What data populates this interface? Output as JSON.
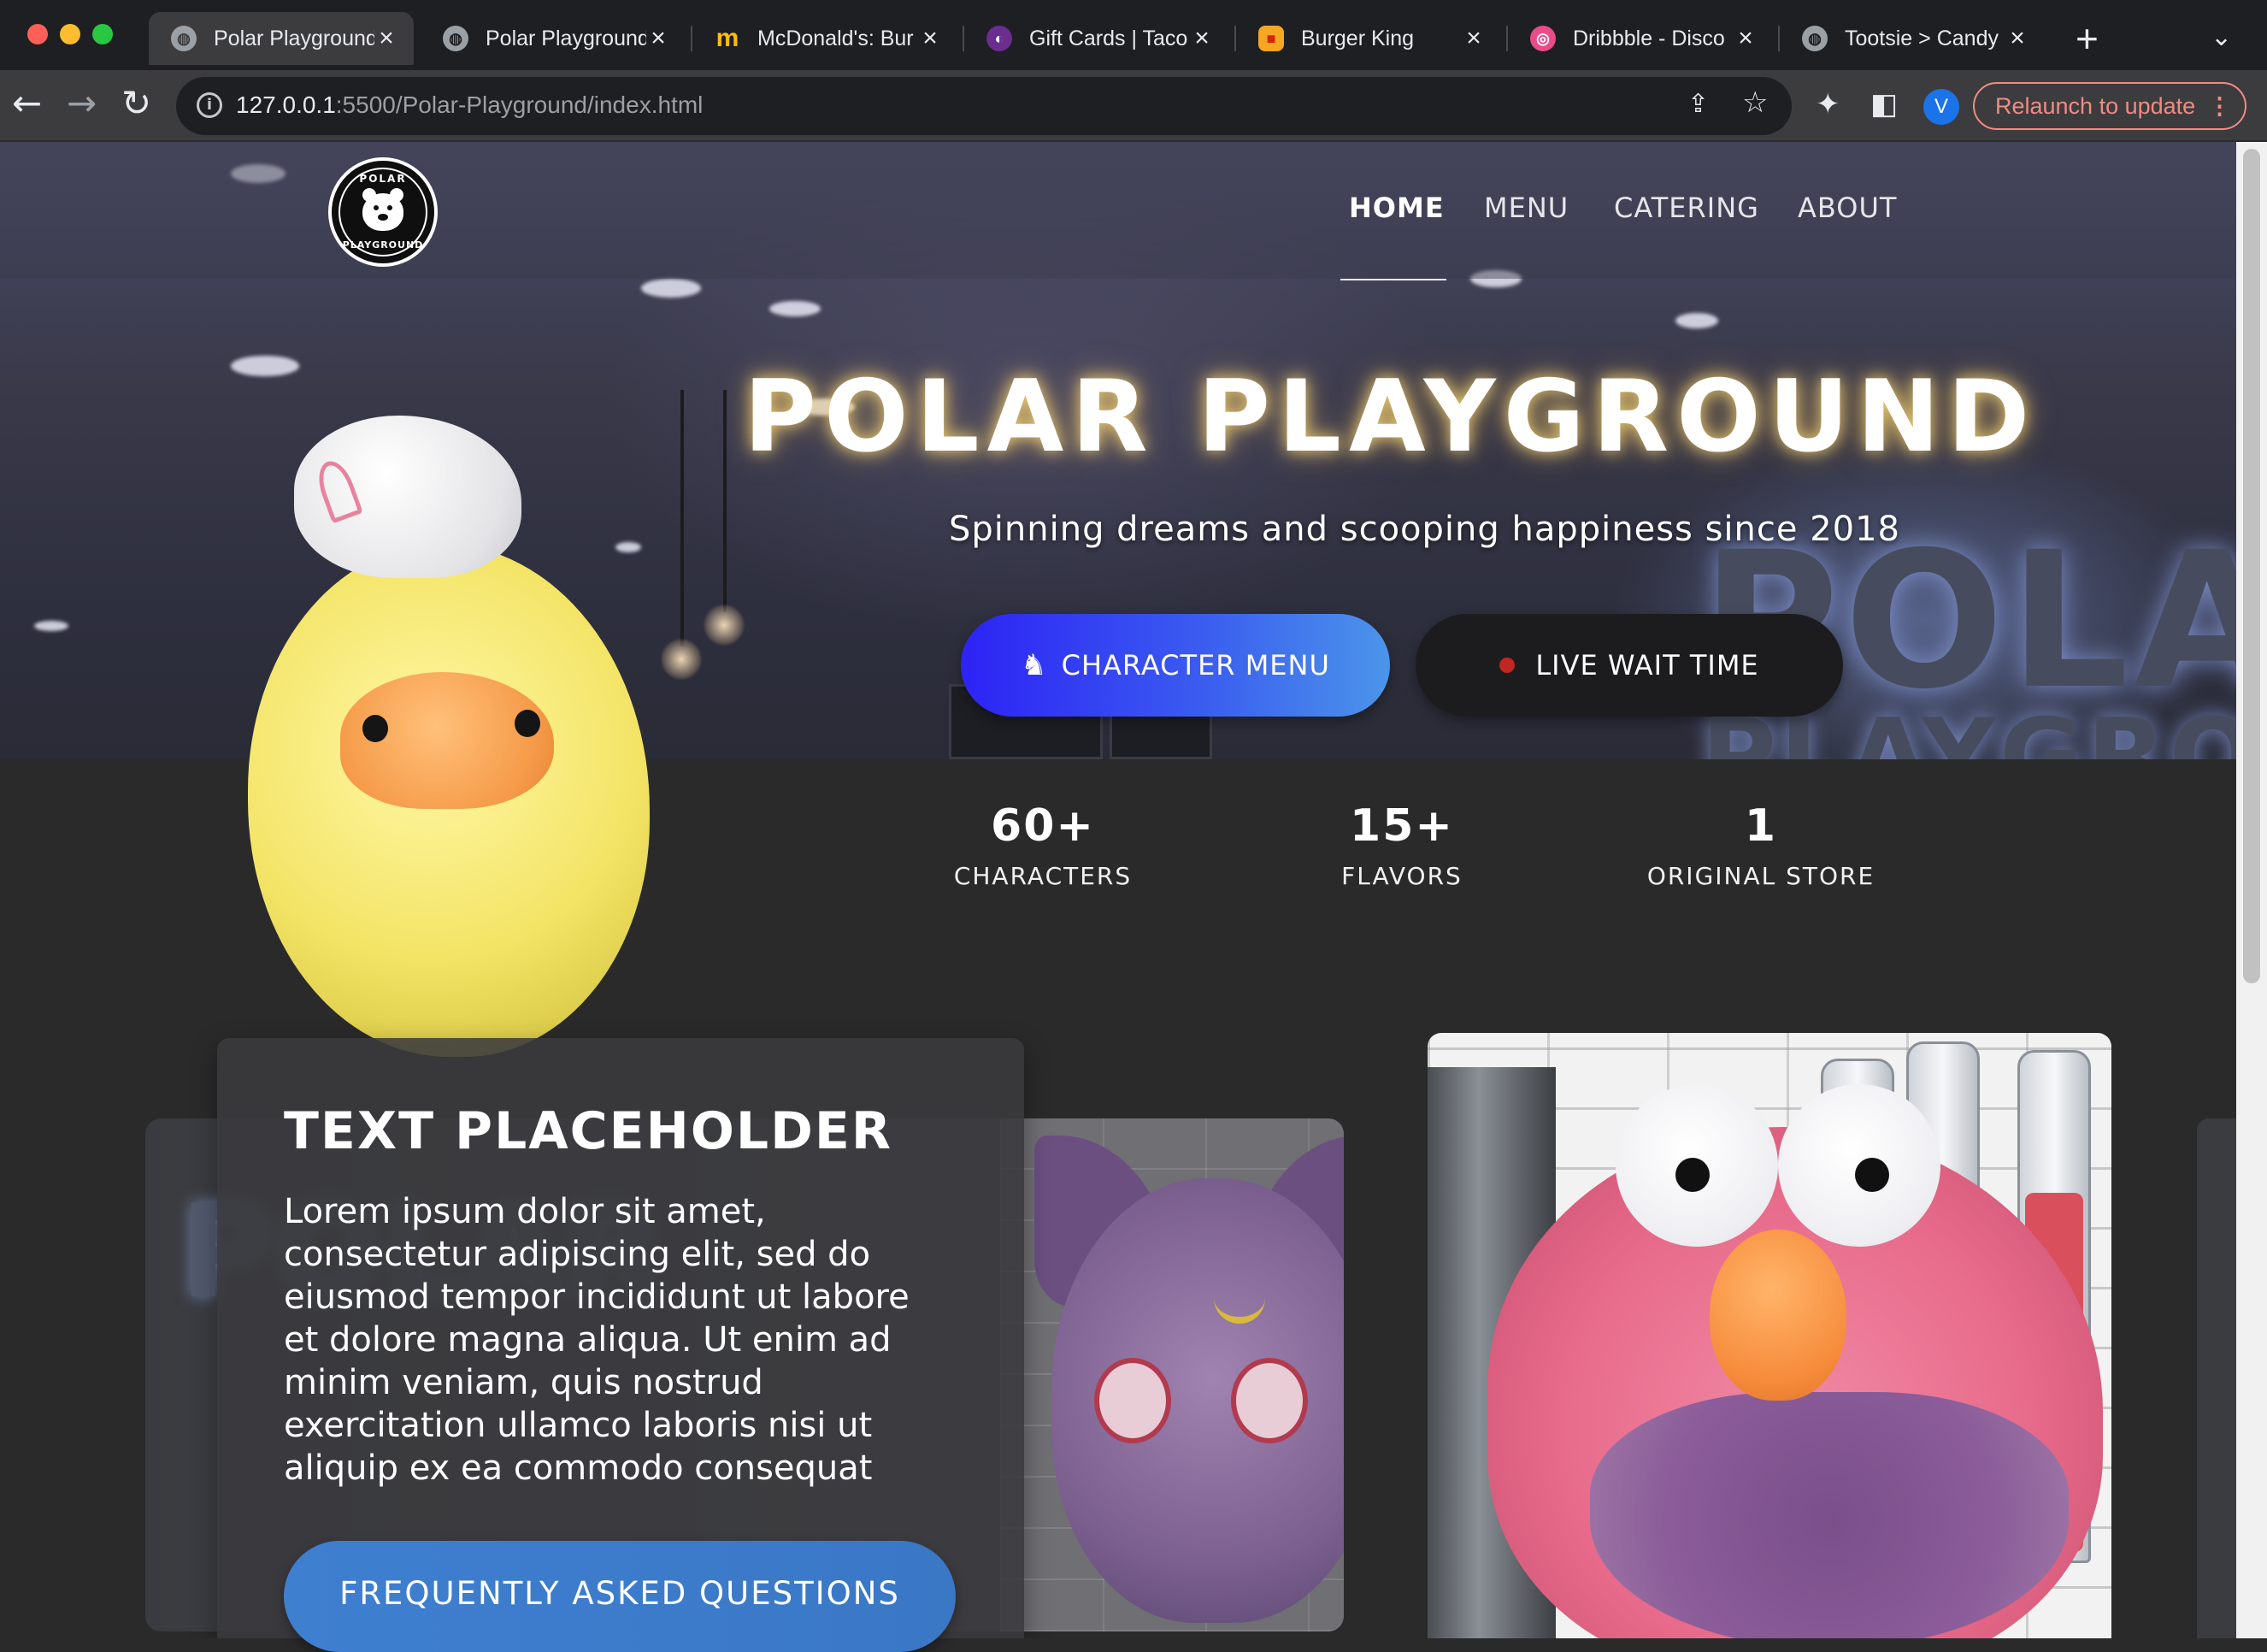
{
  "browser": {
    "tabs": [
      {
        "title": "Polar Playground",
        "active": true,
        "icon": "globe-icon"
      },
      {
        "title": "Polar Playground",
        "active": false,
        "icon": "globe-icon"
      },
      {
        "title": "McDonald's: Bur",
        "active": false,
        "icon": "mcdonalds-icon"
      },
      {
        "title": "Gift Cards | Taco",
        "active": false,
        "icon": "taco-bell-icon"
      },
      {
        "title": "Burger King",
        "active": false,
        "icon": "burger-king-icon"
      },
      {
        "title": "Dribbble - Disco",
        "active": false,
        "icon": "dribbble-icon"
      },
      {
        "title": "Tootsie > Candy",
        "active": false,
        "icon": "globe-icon"
      }
    ],
    "url_host": "127.0.0.1",
    "url_rest": ":5500/Polar-Playground/index.html",
    "profile_initial": "V",
    "relaunch_label": "Relaunch to update"
  },
  "site": {
    "logo_top": "POLAR",
    "logo_bottom": "PLAYGROUND",
    "nav": {
      "home": "HOME",
      "menu": "MENU",
      "catering": "CATERING",
      "about": "ABOUT"
    },
    "hero": {
      "title": "POLAR PLAYGROUND",
      "subtitle": "Spinning dreams and scooping happiness since 2018",
      "sign_line1": "POLA",
      "sign_line2": "PLAYGROU",
      "primary_button": "CHARACTER MENU",
      "secondary_button": "LIVE WAIT TIME"
    },
    "stats": [
      {
        "value": "60+",
        "label": "CHARACTERS"
      },
      {
        "value": "15+",
        "label": "FLAVORS"
      },
      {
        "value": "1",
        "label": "ORIGINAL STORE"
      }
    ],
    "feature": {
      "heading": "TEXT PLACEHOLDER",
      "body": "Lorem ipsum dolor sit amet, consectetur adipiscing elit, sed do eiusmod tempor incididunt ut labore et dolore magna aliqua. Ut enim ad minim veniam, quis nostrud exercitation ullamco laboris nisi ut aliquip ex ea commodo consequat",
      "button": "FREQUENTLY ASKED QUESTIONS"
    }
  }
}
